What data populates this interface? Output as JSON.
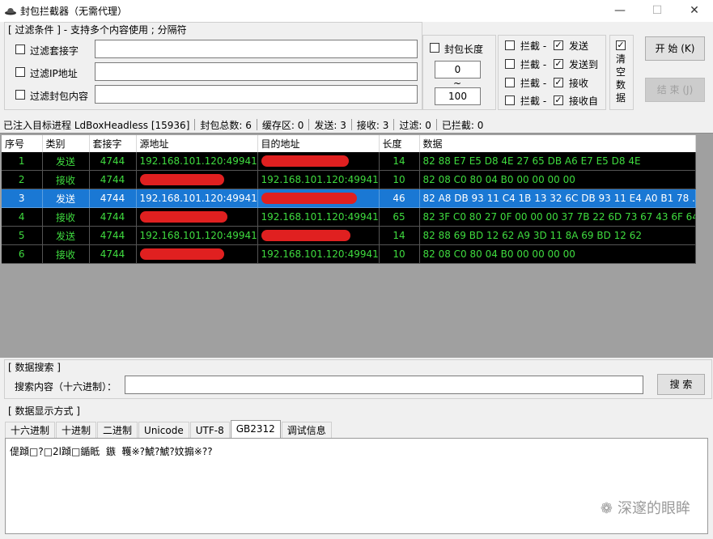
{
  "window": {
    "title": "封包拦截器（无需代理）",
    "minimize": "—",
    "maximize": "☐",
    "close": "✕"
  },
  "filter": {
    "group_title": "[ 过滤条件 ] - 支持多个内容使用 ; 分隔符",
    "socket_label": "过滤套接字",
    "ip_label": "过滤IP地址",
    "content_label": "过滤封包内容",
    "socket_value": "",
    "ip_value": "",
    "content_value": ""
  },
  "length": {
    "label": "封包长度",
    "min": "0",
    "tilde": "~",
    "max": "100"
  },
  "intercept": {
    "rows": [
      {
        "intercept_label": "拦截 -",
        "dir_label": "发送",
        "checked": true
      },
      {
        "intercept_label": "拦截 -",
        "dir_label": "发送到",
        "checked": true
      },
      {
        "intercept_label": "拦截 -",
        "dir_label": "接收",
        "checked": true
      },
      {
        "intercept_label": "拦截 -",
        "dir_label": "接收自",
        "checked": true
      }
    ]
  },
  "clear": {
    "label_1": "清",
    "label_2": "空",
    "label_3": "数",
    "label_4": "据"
  },
  "buttons": {
    "start": "开 始 (K)",
    "stop": "结 束 (J)"
  },
  "status": {
    "process": "已注入目标进程 LdBoxHeadless [15936]",
    "total": "封包总数:  6",
    "buffer": "缓存区:  0",
    "send": "发送:  3",
    "recv": "接收:  3",
    "filter": "过滤:  0",
    "blocked": "已拦截:  0"
  },
  "table": {
    "headers": [
      "序号",
      "类别",
      "套接字",
      "源地址",
      "目的地址",
      "长度",
      "数据"
    ],
    "rows": [
      {
        "no": "1",
        "type": "发送",
        "socket": "4744",
        "src": "192.168.101.120:49941",
        "dst": "",
        "len": "14",
        "data": "82 88 E7 E5 D8 4E 27 65 DB A6 E7 E5 D8 4E"
      },
      {
        "no": "2",
        "type": "接收",
        "socket": "4744",
        "src": "",
        "dst": "192.168.101.120:49941",
        "len": "10",
        "data": "82 08 C0 80 04 B0 00 00 00 00"
      },
      {
        "no": "3",
        "type": "发送",
        "socket": "4744",
        "src": "192.168.101.120:49941",
        "dst": "",
        "len": "46",
        "data": "82 A8 DB 93 11 C4 1B 13 32 6C DB 93 11 E4 A0 B1 78 ..."
      },
      {
        "no": "4",
        "type": "接收",
        "socket": "4744",
        "src": "",
        "dst": "192.168.101.120:49941",
        "len": "65",
        "data": "82 3F C0 80 27 0F 00 00 00 37 7B 22 6D 73 67 43 6F 64..."
      },
      {
        "no": "5",
        "type": "发送",
        "socket": "4744",
        "src": "192.168.101.120:49941",
        "dst": "",
        "len": "14",
        "data": "82 88 69 BD 12 62 A9 3D 11 8A 69 BD 12 62"
      },
      {
        "no": "6",
        "type": "接收",
        "socket": "4744",
        "src": "",
        "dst": "192.168.101.120:49941",
        "len": "10",
        "data": "82 08 C0 80 04 B0 00 00 00 00"
      }
    ]
  },
  "search": {
    "group_title": "[ 数据搜索 ]",
    "label": "搜索内容（十六进制）：",
    "value": "",
    "button": "搜 索"
  },
  "display": {
    "group_title": "[ 数据显示方式 ]",
    "tabs": [
      "十六进制",
      "十进制",
      "二进制",
      "Unicode",
      "UTF-8",
      "GB2312",
      "调试信息"
    ],
    "output": "偍蹞□?□2l蹞□鍎眡  鏃  韄※?鯱?鯱?妏搧※??"
  },
  "watermark": "深邃的眼眸",
  "colors": {
    "grid_bg": "#000000",
    "grid_text": "#3fdc3f",
    "selected_row": "#1a78d4",
    "redaction": "#e02020"
  }
}
